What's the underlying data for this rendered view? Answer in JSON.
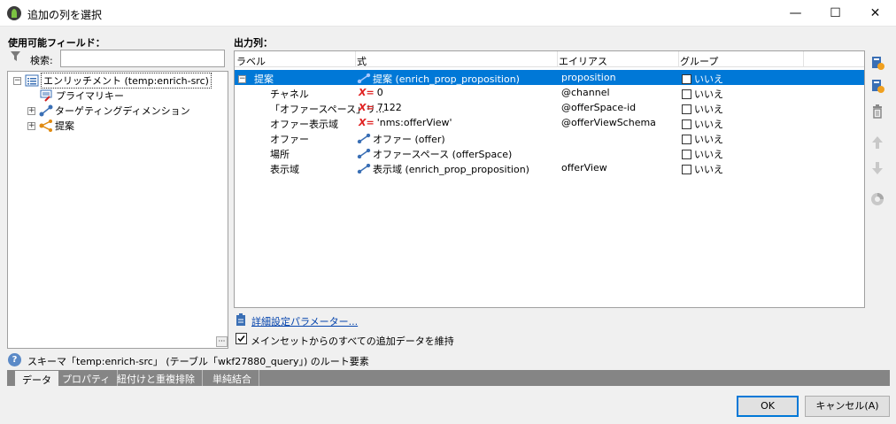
{
  "window": {
    "title": "追加の列を選択",
    "minimize_glyph": "—",
    "maximize_glyph": "☐",
    "close_glyph": "✕"
  },
  "left": {
    "heading": "使用可能フィールド：",
    "search_label": "検索:",
    "search_value": "",
    "tree": [
      {
        "label": "エンリッチメント (temp:enrich-src)",
        "icon": "schema-icon",
        "expanded": true,
        "selected": true
      },
      {
        "label": "プライマリキー",
        "icon": "key-icon"
      },
      {
        "label": "ターゲティングディメンション",
        "icon": "link-icon",
        "expanded": false
      },
      {
        "label": "提案",
        "icon": "collection-icon",
        "expanded": false
      }
    ],
    "dots_label": "···"
  },
  "right": {
    "heading": "出力列：",
    "columns": [
      "ラベル",
      "式",
      "エイリアス",
      "グループ"
    ],
    "rows": [
      {
        "label": "提案",
        "expr_type": "link",
        "expr": "提案 (enrich_prop_proposition)",
        "alias": "proposition",
        "group": "いいえ",
        "selected": true,
        "toggle": "⊟"
      },
      {
        "label": "チャネル",
        "expr_type": "value",
        "expr": "0",
        "alias": "@channel",
        "group": "いいえ"
      },
      {
        "label": "「オファースペース」リ...",
        "expr_type": "value",
        "expr": "7122",
        "alias": "@offerSpace-id",
        "group": "いいえ"
      },
      {
        "label": "オファー表示域",
        "expr_type": "value",
        "expr": "'nms:offerView'",
        "alias": "@offerViewSchema",
        "group": "いいえ"
      },
      {
        "label": "オファー",
        "expr_type": "link",
        "expr": "オファー (offer)",
        "alias": "",
        "group": "いいえ"
      },
      {
        "label": "場所",
        "expr_type": "link",
        "expr": "オファースペース (offerSpace)",
        "alias": "",
        "group": "いいえ"
      },
      {
        "label": "表示域",
        "expr_type": "link",
        "expr": "表示域 (enrich_prop_proposition)",
        "alias": "offerView",
        "group": "いいえ"
      }
    ],
    "expr_marker": "X=",
    "advanced_link": "詳細設定パラメーター...",
    "keep_data_label": "メインセットからのすべての追加データを維持"
  },
  "status": {
    "text": "スキーマ「temp:enrich-src」 (テーブル「wkf27880_query」) のルート要素"
  },
  "tabs": [
    "データ",
    "プロパティ",
    "紐付けと重複排除",
    "単純結合"
  ],
  "buttons": {
    "ok": "OK",
    "cancel": "キャンセル(A)"
  },
  "colors": {
    "selection": "#0078d7",
    "link": "#0645ad",
    "expr_marker": "#e02020"
  }
}
